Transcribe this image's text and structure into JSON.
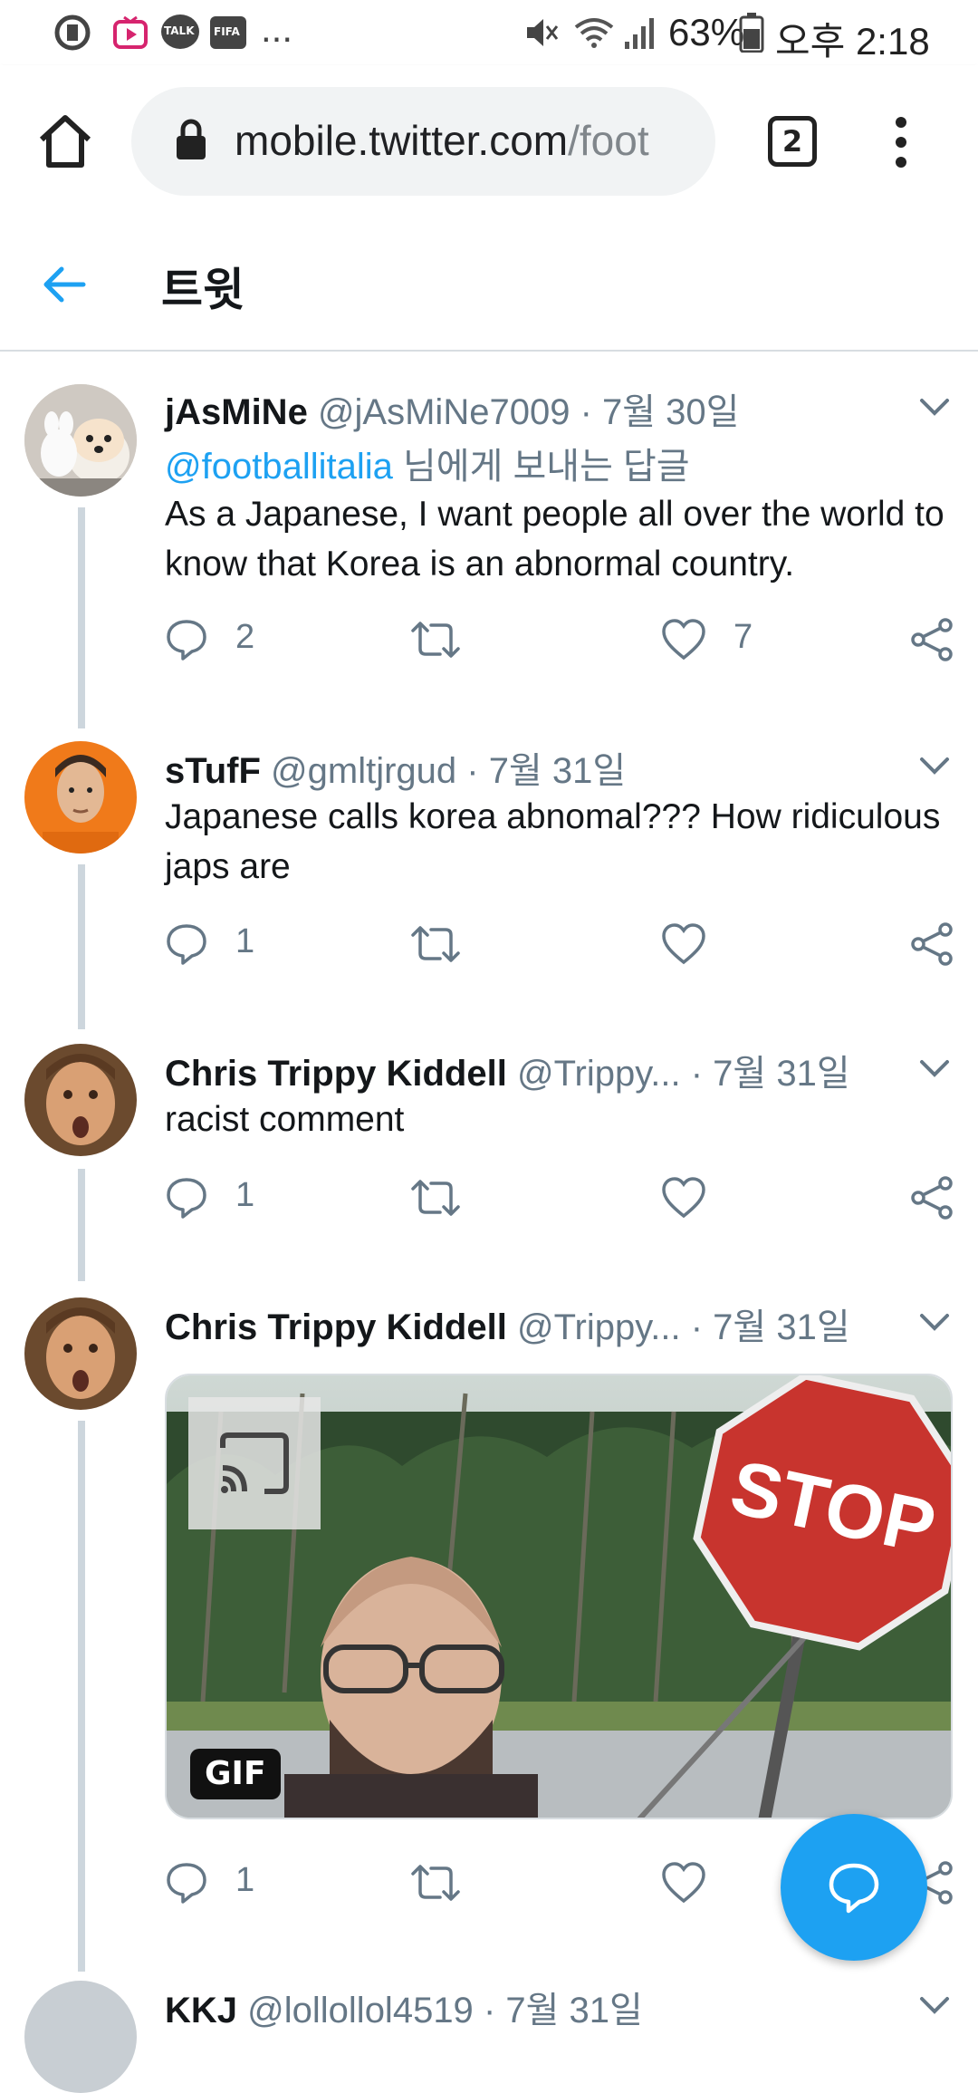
{
  "status_bar": {
    "battery": "63%",
    "time": "오후 2:18",
    "more": "...",
    "notif_talk": "TALK",
    "notif_fifa": "FIFA"
  },
  "browser": {
    "url_host": "mobile.twitter.com",
    "url_path": "/foot",
    "tab_count": "2"
  },
  "header": {
    "title": "트윗"
  },
  "tweets": [
    {
      "name": "jAsMiNe",
      "handle": "@jAsMiNe7009",
      "sep": "·",
      "date": "7월 30일",
      "reply_mention": "@footballitalia",
      "reply_suffix": " 님에게 보내는 답글",
      "text": "As a Japanese, I want people all over the world to know that Korea is an abnormal country.",
      "replies": "2",
      "retweets": "",
      "likes": "7"
    },
    {
      "name": "sTufF",
      "handle": "@gmltjrgud",
      "sep": "·",
      "date": "7월 31일",
      "text": "Japanese calls korea abnomal??? How ridiculous japs are",
      "replies": "1",
      "retweets": "",
      "likes": ""
    },
    {
      "name": "Chris Trippy Kiddell",
      "handle": "@Trippy...",
      "sep": "·",
      "date": "7월 31일",
      "text": "racist comment",
      "replies": "1",
      "retweets": "",
      "likes": ""
    },
    {
      "name": "Chris Trippy Kiddell",
      "handle": "@Trippy...",
      "sep": "·",
      "date": "7월 31일",
      "media_badge": "GIF",
      "media_sign_text": "STOP",
      "replies": "1",
      "retweets": "",
      "likes": ""
    },
    {
      "name": "KKJ",
      "handle": "@lollollol4519",
      "sep": "·",
      "date": "7월 31일"
    }
  ],
  "colors": {
    "accent": "#1da1f2",
    "text": "#14171a",
    "secondary": "#657786",
    "thread_line": "#cdd6dd"
  }
}
